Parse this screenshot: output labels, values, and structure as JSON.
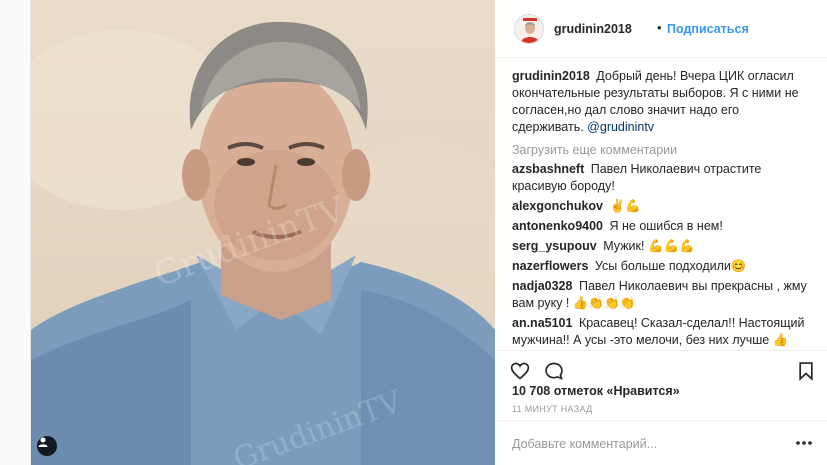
{
  "header": {
    "username": "grudinin2018",
    "separator": "•",
    "follow_label": "Подписаться"
  },
  "caption": {
    "username": "grudinin2018",
    "text": "Добрый день! Вчера ЦИК огласил окончательные результаты выборов. Я с ними не согласен,но дал слово значит надо его сдерживать.",
    "mention": "@grudinintv"
  },
  "load_more_label": "Загрузить еще комментарии",
  "comments": [
    {
      "username": "azsbashneft",
      "text": "Павел Николаевич отрастите красивую бороду!"
    },
    {
      "username": "alexgonchukov",
      "text": "✌💪"
    },
    {
      "username": "antonenko9400",
      "text": "Я не ошибся в нем!"
    },
    {
      "username": "serg_ysupouv",
      "text": "Мужик! 💪💪💪"
    },
    {
      "username": "nazerflowers",
      "text": "Усы больше подходили😊"
    },
    {
      "username": "nadja0328",
      "text": "Павел Николаевич вы прекрасны , жму вам руку ! 👍👏👏👏"
    },
    {
      "username": "an.na5101",
      "text": "Красавец! Сказал-сделал!! Настоящий мужчина!! А усы -это мелочи, без них лучше 👍 Пост министра СХ - подарков, праздников, чистой"
    }
  ],
  "likes_text": "10 708 отметок «Нравится»",
  "time_text": "11 МИНУТ НАЗАД",
  "add_comment_placeholder": "Добавьте комментарий...",
  "icons": {
    "like": "heart-icon",
    "comment": "comment-icon",
    "save": "bookmark-icon",
    "more": "ellipsis-icon",
    "tag": "user-tag-icon"
  },
  "colors": {
    "link": "#3897f0",
    "mention": "#003569",
    "muted": "#999999"
  }
}
